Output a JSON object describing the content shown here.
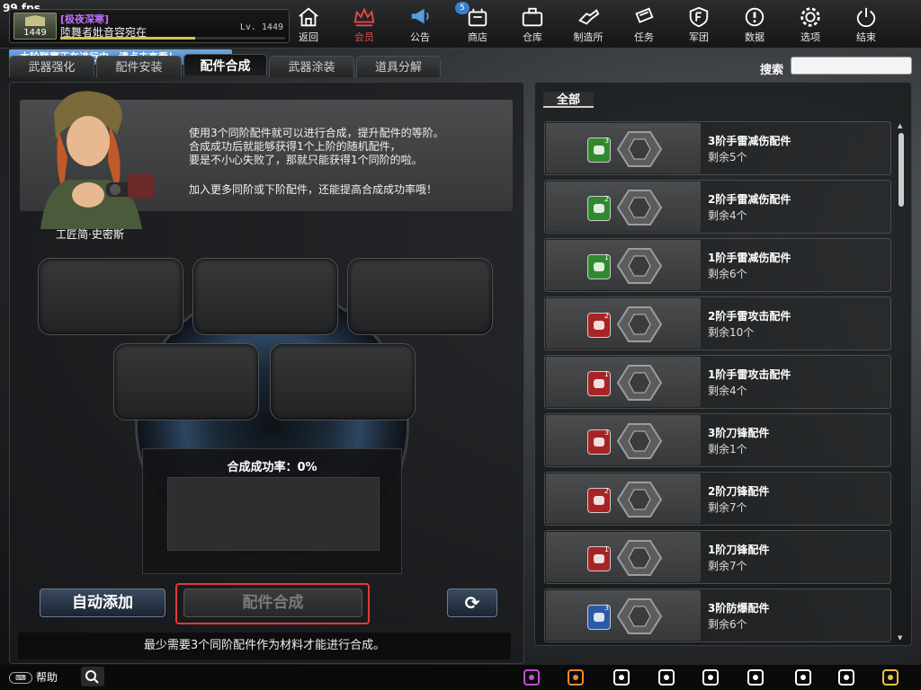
{
  "fps": "99 fps",
  "player": {
    "clan": "[极夜深寒]",
    "name": "陸舞者妣音容宛在",
    "level": "Lv. 1449",
    "rank": "1449",
    "xp_fraction": 0.6
  },
  "banner": {
    "text": "本轮联赛正在进行中，请点击查看！",
    "close": "×"
  },
  "topnav": [
    {
      "label": "返回",
      "icon": "home-icon"
    },
    {
      "label": "会员",
      "icon": "crown-icon",
      "color": "#e24a4a"
    },
    {
      "label": "公告",
      "icon": "megaphone-icon",
      "badge": "5"
    },
    {
      "label": "商店",
      "icon": "shop-icon"
    },
    {
      "label": "仓库",
      "icon": "briefcase-icon"
    },
    {
      "label": "制造所",
      "icon": "wrench-icon"
    },
    {
      "label": "任务",
      "icon": "task-icon"
    },
    {
      "label": "军团",
      "icon": "shield-icon"
    },
    {
      "label": "数据",
      "icon": "info-icon"
    },
    {
      "label": "选项",
      "icon": "gear-icon"
    },
    {
      "label": "结束",
      "icon": "power-icon"
    }
  ],
  "tabs": [
    "武器强化",
    "配件安装",
    "配件合成",
    "武器涂装",
    "道具分解"
  ],
  "search": {
    "label": "搜索",
    "value": ""
  },
  "info": {
    "text": "使用3个同阶配件就可以进行合成，提升配件的等阶。\n合成成功后就能够获得1个上阶的随机配件，\n要是不小心失败了，那就只能获得1个同阶的啦。",
    "text2": "加入更多同阶或下阶配件，还能提高合成成功率哦！",
    "npc": "工匠简·史密斯"
  },
  "rate": "合成成功率：0%",
  "buttons": {
    "auto_add": "自动添加",
    "craft": "配件合成"
  },
  "hint": "最少需要3个同阶配件作为材料才能进行合成。",
  "filter_tab": "全部",
  "items": [
    {
      "name": "3阶手雷减伤配件",
      "count": "剩余5个",
      "tier": "3",
      "color": "#2f8a2f"
    },
    {
      "name": "2阶手雷减伤配件",
      "count": "剩余4个",
      "tier": "2",
      "color": "#2f8a2f"
    },
    {
      "name": "1阶手雷减伤配件",
      "count": "剩余6个",
      "tier": "1",
      "color": "#2f8a2f"
    },
    {
      "name": "2阶手雷攻击配件",
      "count": "剩余10个",
      "tier": "2",
      "color": "#a82424"
    },
    {
      "name": "1阶手雷攻击配件",
      "count": "剩余4个",
      "tier": "1",
      "color": "#a82424"
    },
    {
      "name": "3阶刀锋配件",
      "count": "剩余1个",
      "tier": "3",
      "color": "#a82424"
    },
    {
      "name": "2阶刀锋配件",
      "count": "剩余7个",
      "tier": "2",
      "color": "#a82424"
    },
    {
      "name": "1阶刀锋配件",
      "count": "剩余7个",
      "tier": "1",
      "color": "#a82424"
    },
    {
      "name": "3阶防爆配件",
      "count": "剩余6个",
      "tier": "3",
      "color": "#2a5aa8"
    }
  ],
  "bottom": {
    "help": "帮助",
    "kb": "⌨"
  }
}
